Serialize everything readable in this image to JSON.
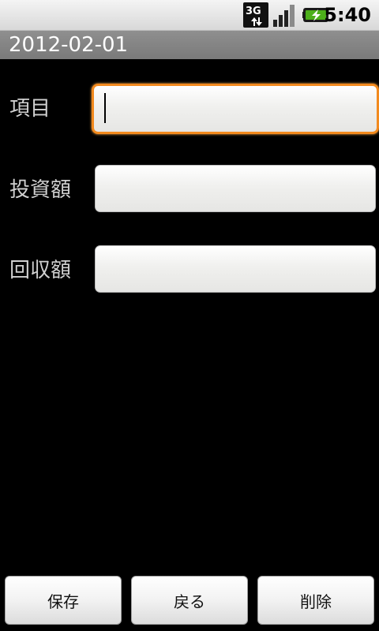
{
  "status_bar": {
    "network_label": "3G",
    "time": "5:40",
    "icons": [
      "network-3g-icon",
      "signal-strength-icon",
      "battery-charging-icon"
    ]
  },
  "title_bar": {
    "date": "2012-02-01"
  },
  "form": {
    "item": {
      "label": "項目",
      "value": "",
      "focused": true
    },
    "investment": {
      "label": "投資額",
      "value": ""
    },
    "recovery": {
      "label": "回収額",
      "value": ""
    }
  },
  "buttons": {
    "save": "保存",
    "back": "戻る",
    "delete": "削除"
  },
  "colors": {
    "focus_border": "#f28a1e",
    "title_bar_bg": "#858585",
    "battery_accent": "#4caf1a"
  }
}
